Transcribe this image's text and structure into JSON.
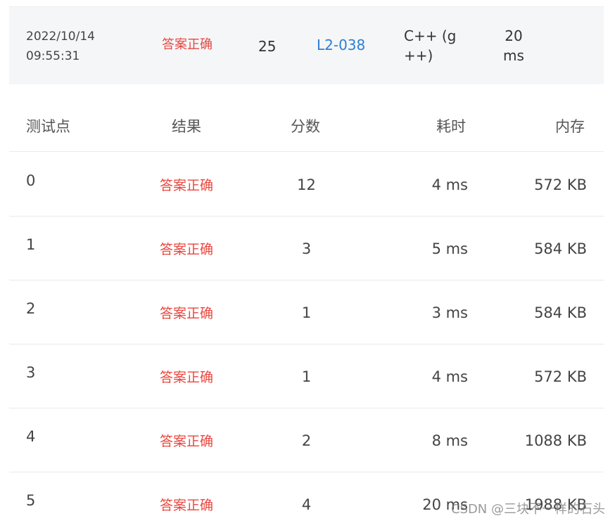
{
  "submission": {
    "date": "2022/10/14",
    "time": "09:55:31",
    "status": "答案正确",
    "score": "25",
    "problem": "L2-038",
    "language_line1": "C++ (g",
    "language_line2": "++)",
    "runtime_line1": "20",
    "runtime_line2": "ms",
    "colors": {
      "status": "#e8473f",
      "link": "#2b7fd8",
      "summary_bg": "#f5f6f8"
    }
  },
  "table": {
    "headers": {
      "case": "测试点",
      "result": "结果",
      "score": "分数",
      "time": "耗时",
      "memory": "内存"
    },
    "rows": [
      {
        "case": "0",
        "result": "答案正确",
        "score": "12",
        "time": "4 ms",
        "memory": "572 KB"
      },
      {
        "case": "1",
        "result": "答案正确",
        "score": "3",
        "time": "5 ms",
        "memory": "584 KB"
      },
      {
        "case": "2",
        "result": "答案正确",
        "score": "1",
        "time": "3 ms",
        "memory": "584 KB"
      },
      {
        "case": "3",
        "result": "答案正确",
        "score": "1",
        "time": "4 ms",
        "memory": "572 KB"
      },
      {
        "case": "4",
        "result": "答案正确",
        "score": "2",
        "time": "8 ms",
        "memory": "1088 KB"
      },
      {
        "case": "5",
        "result": "答案正确",
        "score": "4",
        "time": "20 ms",
        "memory": "1988 KB"
      }
    ]
  },
  "watermark": "CSDN @三块不一样的石头"
}
